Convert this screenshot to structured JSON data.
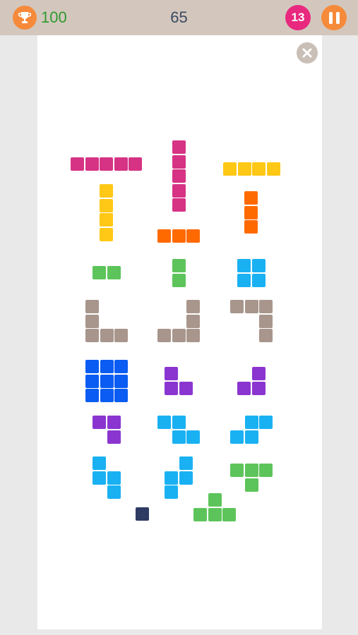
{
  "header": {
    "best_score": "100",
    "current_score": "65",
    "pieces_left": "13"
  },
  "colors": {
    "topbar": "#d3c7bd",
    "orange": "#f58a3a",
    "pink_badge": "#e8297e"
  },
  "pieces": [
    {
      "name": "magenta-i5-horizontal",
      "color": "#d63384",
      "cells": [
        [
          0,
          0
        ],
        [
          1,
          0
        ],
        [
          2,
          0
        ],
        [
          3,
          0
        ],
        [
          4,
          0
        ]
      ]
    },
    {
      "name": "magenta-i5-vertical",
      "color": "#d63384",
      "cells": [
        [
          0,
          0
        ],
        [
          0,
          1
        ],
        [
          0,
          2
        ],
        [
          0,
          3
        ],
        [
          0,
          4
        ]
      ]
    },
    {
      "name": "yellow-i4-horizontal",
      "color": "#ffc816",
      "cells": [
        [
          0,
          0
        ],
        [
          1,
          0
        ],
        [
          2,
          0
        ],
        [
          3,
          0
        ]
      ]
    },
    {
      "name": "yellow-i4-vertical",
      "color": "#ffc816",
      "cells": [
        [
          0,
          0
        ],
        [
          0,
          1
        ],
        [
          0,
          2
        ],
        [
          0,
          3
        ]
      ]
    },
    {
      "name": "orange-i3-horizontal",
      "color": "#ff6a00",
      "cells": [
        [
          0,
          0
        ],
        [
          1,
          0
        ],
        [
          2,
          0
        ]
      ]
    },
    {
      "name": "orange-i3-vertical",
      "color": "#ff6a00",
      "cells": [
        [
          0,
          0
        ],
        [
          0,
          1
        ],
        [
          0,
          2
        ]
      ]
    },
    {
      "name": "green-i2-horizontal",
      "color": "#5cc45a",
      "cells": [
        [
          0,
          0
        ],
        [
          1,
          0
        ]
      ]
    },
    {
      "name": "green-i2-vertical",
      "color": "#5cc45a",
      "cells": [
        [
          0,
          0
        ],
        [
          0,
          1
        ]
      ]
    },
    {
      "name": "cyan-square-2x2",
      "color": "#1ab1f2",
      "cells": [
        [
          0,
          0
        ],
        [
          1,
          0
        ],
        [
          0,
          1
        ],
        [
          1,
          1
        ]
      ]
    },
    {
      "name": "taupe-big-l-a",
      "color": "#a8958b",
      "cells": [
        [
          0,
          0
        ],
        [
          0,
          1
        ],
        [
          0,
          2
        ],
        [
          1,
          2
        ],
        [
          2,
          2
        ]
      ]
    },
    {
      "name": "taupe-big-l-b",
      "color": "#a8958b",
      "cells": [
        [
          2,
          0
        ],
        [
          2,
          1
        ],
        [
          2,
          2
        ],
        [
          1,
          2
        ],
        [
          0,
          2
        ]
      ]
    },
    {
      "name": "taupe-big-l-c",
      "color": "#a8958b",
      "cells": [
        [
          0,
          0
        ],
        [
          1,
          0
        ],
        [
          2,
          0
        ],
        [
          2,
          1
        ],
        [
          2,
          2
        ]
      ]
    },
    {
      "name": "blue-square-3x3",
      "color": "#0a5cf2",
      "cells": [
        [
          0,
          0
        ],
        [
          1,
          0
        ],
        [
          2,
          0
        ],
        [
          0,
          1
        ],
        [
          1,
          1
        ],
        [
          2,
          1
        ],
        [
          0,
          2
        ],
        [
          1,
          2
        ],
        [
          2,
          2
        ]
      ]
    },
    {
      "name": "purple-small-l-a",
      "color": "#8a35d0",
      "cells": [
        [
          0,
          0
        ],
        [
          0,
          1
        ],
        [
          1,
          1
        ]
      ]
    },
    {
      "name": "purple-small-l-b",
      "color": "#8a35d0",
      "cells": [
        [
          1,
          0
        ],
        [
          1,
          1
        ],
        [
          0,
          1
        ]
      ]
    },
    {
      "name": "purple-small-l-c",
      "color": "#8a35d0",
      "cells": [
        [
          0,
          0
        ],
        [
          1,
          0
        ],
        [
          1,
          1
        ]
      ]
    },
    {
      "name": "cyan-z-horizontal",
      "color": "#1ab1f2",
      "cells": [
        [
          0,
          0
        ],
        [
          1,
          0
        ],
        [
          1,
          1
        ],
        [
          2,
          1
        ]
      ]
    },
    {
      "name": "cyan-s-horizontal",
      "color": "#1ab1f2",
      "cells": [
        [
          1,
          0
        ],
        [
          2,
          0
        ],
        [
          0,
          1
        ],
        [
          1,
          1
        ]
      ]
    },
    {
      "name": "cyan-s-vertical",
      "color": "#1ab1f2",
      "cells": [
        [
          0,
          0
        ],
        [
          0,
          1
        ],
        [
          1,
          1
        ],
        [
          1,
          2
        ]
      ]
    },
    {
      "name": "cyan-z-vertical",
      "color": "#1ab1f2",
      "cells": [
        [
          1,
          0
        ],
        [
          1,
          1
        ],
        [
          0,
          1
        ],
        [
          0,
          2
        ]
      ]
    },
    {
      "name": "green-t-down",
      "color": "#5cc45a",
      "cells": [
        [
          0,
          0
        ],
        [
          1,
          0
        ],
        [
          2,
          0
        ],
        [
          1,
          1
        ]
      ]
    },
    {
      "name": "navy-single-dot",
      "color": "#2e3b63",
      "cells": [
        [
          0,
          0
        ]
      ]
    },
    {
      "name": "green-t-up",
      "color": "#5cc45a",
      "cells": [
        [
          1,
          0
        ],
        [
          0,
          1
        ],
        [
          1,
          1
        ],
        [
          2,
          1
        ]
      ]
    }
  ]
}
